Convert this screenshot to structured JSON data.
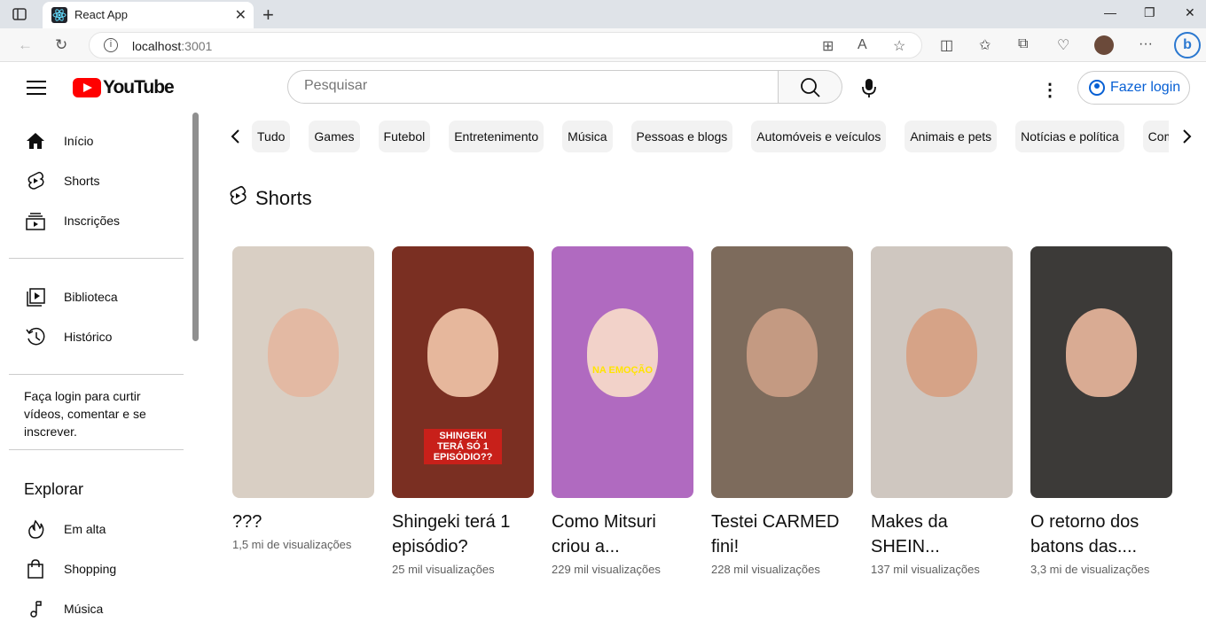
{
  "browser": {
    "tab_title": "React App",
    "url_host": "localhost",
    "url_port": ":3001"
  },
  "header": {
    "logo_text": "YouTube",
    "search_placeholder": "Pesquisar",
    "login_label": "Fazer login"
  },
  "sidebar": {
    "items_main": [
      {
        "label": "Início",
        "icon": "home-icon"
      },
      {
        "label": "Shorts",
        "icon": "shorts-icon"
      },
      {
        "label": "Inscrições",
        "icon": "subscriptions-icon"
      }
    ],
    "items_library": [
      {
        "label": "Biblioteca",
        "icon": "library-icon"
      },
      {
        "label": "Histórico",
        "icon": "history-icon"
      }
    ],
    "login_prompt": "Faça login para curtir vídeos, comentar e se inscrever.",
    "explore_title": "Explorar",
    "items_explore": [
      {
        "label": "Em alta",
        "icon": "trending-icon"
      },
      {
        "label": "Shopping",
        "icon": "shopping-icon"
      },
      {
        "label": "Música",
        "icon": "music-icon"
      }
    ]
  },
  "chips": [
    "Tudo",
    "Games",
    "Futebol",
    "Entretenimento",
    "Música",
    "Pessoas e blogs",
    "Automóveis e veículos",
    "Animais e pets",
    "Notícias e política",
    "Comédia"
  ],
  "shorts": {
    "section_title": "Shorts",
    "items": [
      {
        "title_line1": "???",
        "title_line2": "",
        "views": "1,5 mi de visualizações",
        "bg": "#d9cfc4",
        "face": "#e3b9a3",
        "caption": ""
      },
      {
        "title_line1": "Shingeki terá 1",
        "title_line2": "episódio?",
        "views": "25 mil visualizações",
        "bg": "#7a2f22",
        "face": "#e6b79c",
        "caption": "SHINGEKI TERÁ SÓ 1 EPISÓDIO??"
      },
      {
        "title_line1": "Como Mitsuri",
        "title_line2": "criou a...",
        "views": "229 mil visualizações",
        "bg": "#b06ac0",
        "face": "#f2d2c9",
        "caption": "NA EMOÇÃO"
      },
      {
        "title_line1": "Testei CARMED",
        "title_line2": "fini!",
        "views": "228 mil visualizações",
        "bg": "#7d6b5c",
        "face": "#c49a82",
        "caption": ""
      },
      {
        "title_line1": "Makes da",
        "title_line2": "SHEIN...",
        "views": "137 mil visualizações",
        "bg": "#cfc7c0",
        "face": "#d6a387",
        "caption": ""
      },
      {
        "title_line1": "O retorno dos",
        "title_line2": "batons das....",
        "views": "3,3 mi de visualizações",
        "bg": "#3c3a38",
        "face": "#d9ab93",
        "caption": ""
      }
    ]
  }
}
